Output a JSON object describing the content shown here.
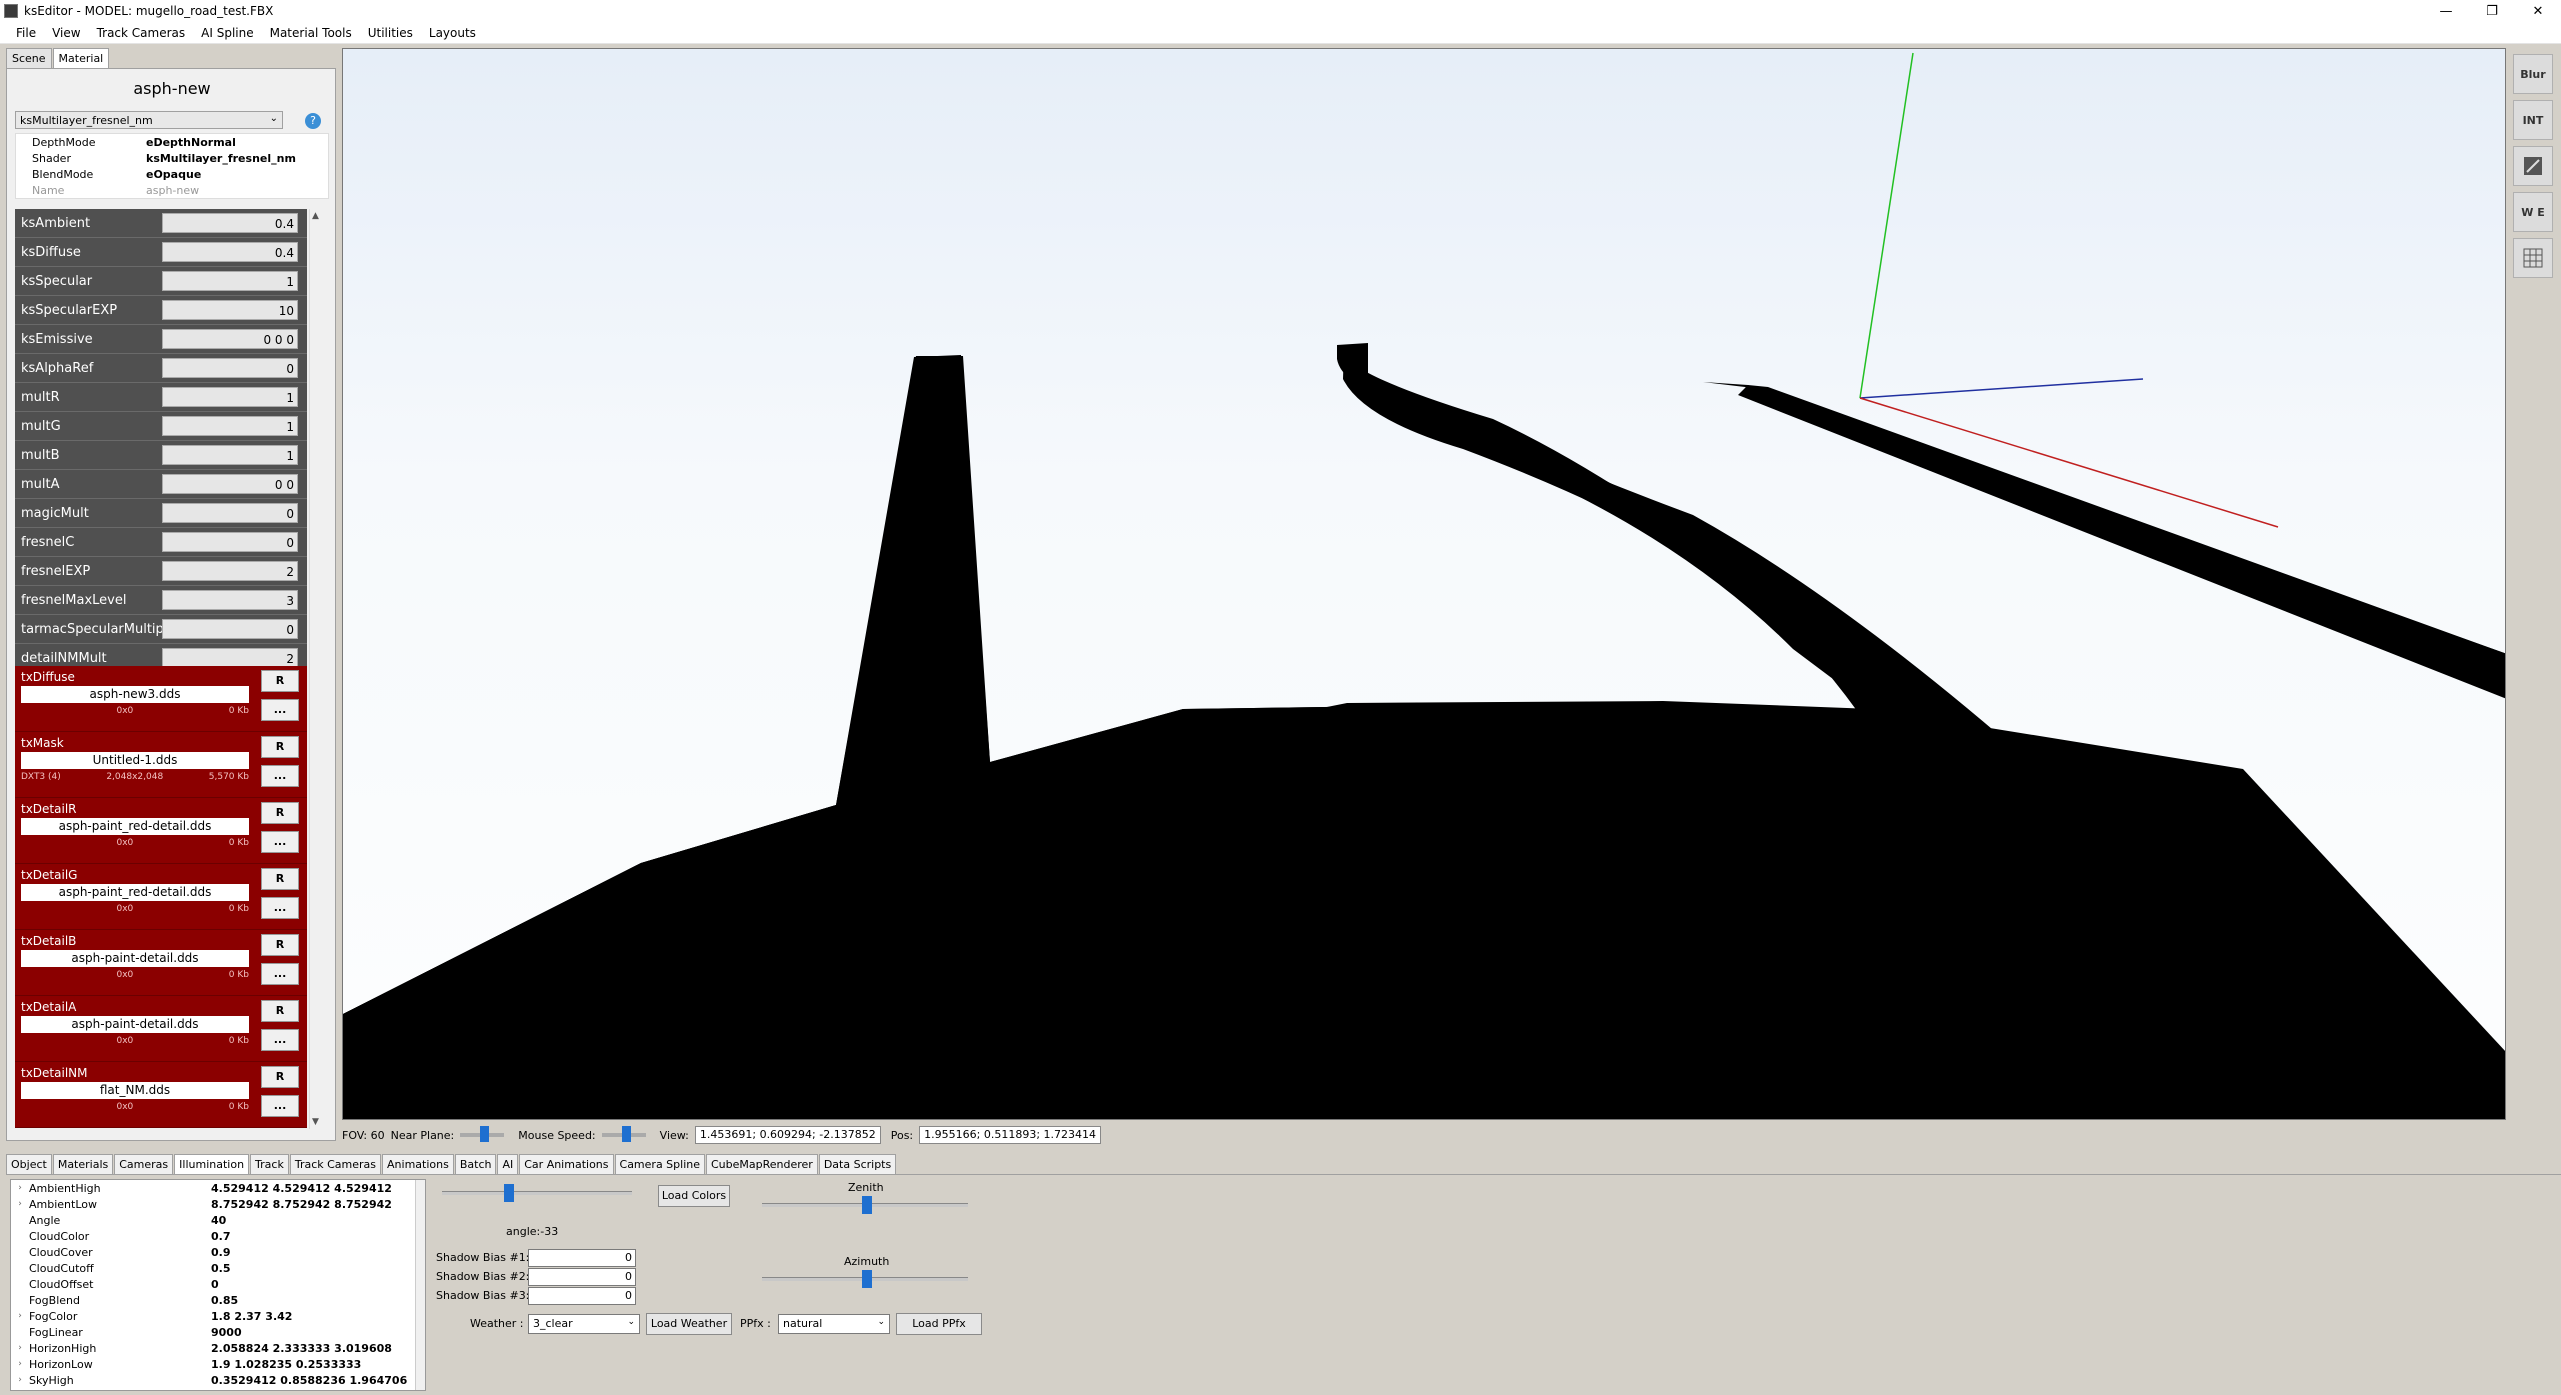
{
  "window": {
    "title": "ksEditor - MODEL: mugello_road_test.FBX",
    "minimize": "—",
    "maximize": "❐",
    "close": "✕"
  },
  "menu": [
    "File",
    "View",
    "Track Cameras",
    "AI Spline",
    "Material Tools",
    "Utilities",
    "Layouts"
  ],
  "left_tabs": [
    "Scene",
    "Material"
  ],
  "material": {
    "name": "asph-new",
    "shader_select": "ksMultilayer_fresnel_nm",
    "help": "?",
    "props": [
      {
        "k": "DepthMode",
        "v": "eDepthNormal"
      },
      {
        "k": "Shader",
        "v": "ksMultilayer_fresnel_nm"
      },
      {
        "k": "BlendMode",
        "v": "eOpaque"
      },
      {
        "k": "Name",
        "v": "asph-new"
      }
    ],
    "params": [
      {
        "label": "ksAmbient",
        "value": "0.4"
      },
      {
        "label": "ksDiffuse",
        "value": "0.4"
      },
      {
        "label": "ksSpecular",
        "value": "1"
      },
      {
        "label": "ksSpecularEXP",
        "value": "10"
      },
      {
        "label": "ksEmissive",
        "value": "0 0 0"
      },
      {
        "label": "ksAlphaRef",
        "value": "0"
      },
      {
        "label": "multR",
        "value": "1"
      },
      {
        "label": "multG",
        "value": "1"
      },
      {
        "label": "multB",
        "value": "1"
      },
      {
        "label": "multA",
        "value": "0 0"
      },
      {
        "label": "magicMult",
        "value": "0"
      },
      {
        "label": "fresnelC",
        "value": "0"
      },
      {
        "label": "fresnelEXP",
        "value": "2"
      },
      {
        "label": "fresnelMaxLevel",
        "value": "3"
      },
      {
        "label": "tarmacSpecularMultipl",
        "value": "0"
      },
      {
        "label": "detailNMMult",
        "value": "2"
      }
    ],
    "textures": [
      {
        "label": "txDiffuse",
        "file": "asph-new3.dds",
        "fmt": "",
        "res": "0x0",
        "size": "0 Kb"
      },
      {
        "label": "txMask",
        "file": "Untitled-1.dds",
        "fmt": "DXT3 (4)",
        "res": "2,048x2,048",
        "size": "5,570 Kb"
      },
      {
        "label": "txDetailR",
        "file": "asph-paint_red-detail.dds",
        "fmt": "",
        "res": "0x0",
        "size": "0 Kb"
      },
      {
        "label": "txDetailG",
        "file": "asph-paint_red-detail.dds",
        "fmt": "",
        "res": "0x0",
        "size": "0 Kb"
      },
      {
        "label": "txDetailB",
        "file": "asph-paint-detail.dds",
        "fmt": "",
        "res": "0x0",
        "size": "0 Kb"
      },
      {
        "label": "txDetailA",
        "file": "asph-paint-detail.dds",
        "fmt": "",
        "res": "0x0",
        "size": "0 Kb"
      },
      {
        "label": "txDetailNM",
        "file": "flat_NM.dds",
        "fmt": "",
        "res": "0x0",
        "size": "0 Kb"
      }
    ],
    "btn_r": "R",
    "btn_more": "..."
  },
  "right_tools": [
    {
      "icon": "blur-icon",
      "label": "Blur"
    },
    {
      "icon": "int-hr-lr-icon",
      "label": "INT"
    },
    {
      "icon": "panel-icon",
      "label": ""
    },
    {
      "icon": "we-icon",
      "label": "W E"
    },
    {
      "icon": "grid-icon",
      "label": ""
    }
  ],
  "status": {
    "fov": "FOV: 60",
    "near_plane": "Near Plane:",
    "near_plane_level": 0.5,
    "mouse_speed": "Mouse Speed:",
    "mouse_speed_level": 0.5,
    "view_label": "View:",
    "view_value": "1.453691; 0.609294; -2.137852",
    "pos_label": "Pos:",
    "pos_value": "1.955166; 0.511893; 1.723414"
  },
  "bottom_tabs": [
    "Object",
    "Materials",
    "Cameras",
    "Illumination",
    "Track",
    "Track Cameras",
    "Animations",
    "Batch",
    "AI",
    "Car Animations",
    "Camera Spline",
    "CubeMapRenderer",
    "Data Scripts"
  ],
  "bottom_active_tab": "Illumination",
  "illumination": [
    {
      "exp": "›",
      "k": "AmbientHigh",
      "v": "4.529412 4.529412 4.529412"
    },
    {
      "exp": "›",
      "k": "AmbientLow",
      "v": "8.752942 8.752942 8.752942"
    },
    {
      "exp": "",
      "k": "Angle",
      "v": "40"
    },
    {
      "exp": "",
      "k": "CloudColor",
      "v": "0.7"
    },
    {
      "exp": "",
      "k": "CloudCover",
      "v": "0.9"
    },
    {
      "exp": "",
      "k": "CloudCutoff",
      "v": "0.5"
    },
    {
      "exp": "",
      "k": "CloudOffset",
      "v": "0"
    },
    {
      "exp": "",
      "k": "FogBlend",
      "v": "0.85"
    },
    {
      "exp": "›",
      "k": "FogColor",
      "v": "1.8 2.37 3.42"
    },
    {
      "exp": "",
      "k": "FogLinear",
      "v": "9000"
    },
    {
      "exp": "›",
      "k": "HorizonHigh",
      "v": "2.058824 2.333333 3.019608"
    },
    {
      "exp": "›",
      "k": "HorizonLow",
      "v": "1.9 1.028235 0.2533333"
    },
    {
      "exp": "›",
      "k": "SkyHigh",
      "v": "0.3529412 0.8588236 1.964706"
    }
  ],
  "controls": {
    "angle_label": "angle:-33",
    "load_colors": "Load Colors",
    "zenith": "Zenith",
    "azimuth": "Azimuth",
    "shadow_bias_1": "Shadow Bias #1:",
    "shadow_bias_2": "Shadow Bias #2:",
    "shadow_bias_3": "Shadow Bias #3:",
    "shadow_bias_1_val": "0",
    "shadow_bias_2_val": "0",
    "shadow_bias_3_val": "0",
    "weather_label": "Weather :",
    "weather_value": "3_clear",
    "load_weather": "Load Weather",
    "ppfx_label": "PPfx :",
    "ppfx_value": "natural",
    "load_ppfx": "Load PPfx"
  }
}
